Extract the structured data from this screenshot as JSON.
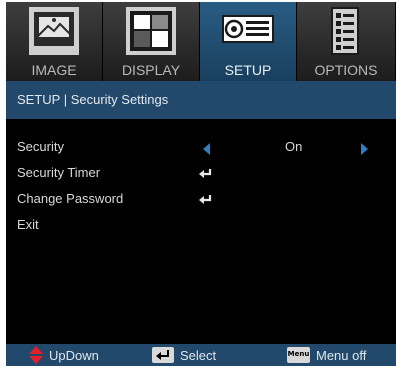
{
  "tabs": [
    {
      "label": "IMAGE",
      "icon": "image-icon",
      "active": false
    },
    {
      "label": "DISPLAY",
      "icon": "display-icon",
      "active": false
    },
    {
      "label": "SETUP",
      "icon": "projector-icon",
      "active": true
    },
    {
      "label": "OPTIONS",
      "icon": "options-list-icon",
      "active": false
    }
  ],
  "header": {
    "title": "SETUP | Security Settings"
  },
  "menu": {
    "items": [
      {
        "label": "Security",
        "value": "On",
        "control": "arrows"
      },
      {
        "label": "Security Timer",
        "control": "enter"
      },
      {
        "label": "Change Password",
        "control": "enter"
      },
      {
        "label": "Exit",
        "control": "none"
      }
    ]
  },
  "footer": {
    "updown": "UpDown",
    "select": "Select",
    "menu_key": "Menu",
    "menu_off": "Menu off"
  },
  "colors": {
    "accent_blue": "#22496b",
    "active_tab": "#285d84",
    "arrow_blue": "#2f7fc1",
    "updown_red": "#e0202a"
  }
}
